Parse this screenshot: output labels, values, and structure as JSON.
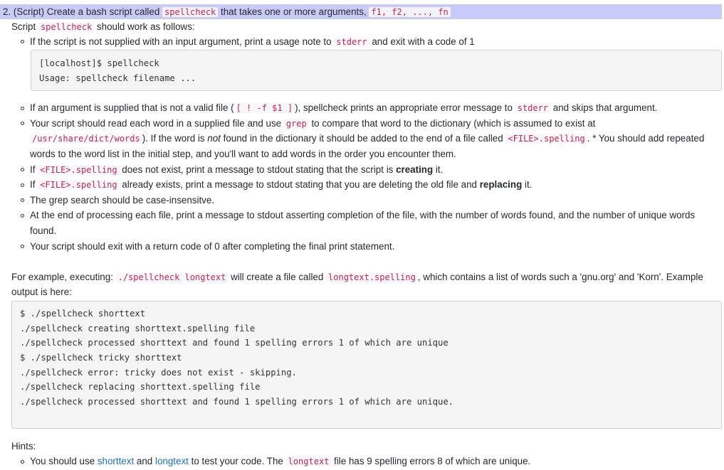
{
  "heading": {
    "prefix": "2. (Script) Create a bash script called ",
    "script_name": "spellcheck",
    "middle": " that takes one or more arguments, ",
    "args": "f1, f2, ..., fn"
  },
  "intro": {
    "pre": "Script ",
    "code": "spellcheck",
    "post": " should work as follows:"
  },
  "bullet1": {
    "pre": "If the script is not supplied with an input argument, print a usage note to ",
    "code": "stderr",
    "post": " and exit with a code of 1"
  },
  "usage_block": [
    "[localhost]$ spellcheck",
    "Usage: spellcheck filename ..."
  ],
  "bullet2": {
    "pre": "If an argument is supplied that is not a valid file (",
    "code1": "[ ! -f $1 ]",
    "mid": "), spellcheck prints an appropriate error message to ",
    "code2": "stderr",
    "post": " and skips that argument."
  },
  "bullet3": {
    "l1_pre": "Your script should read each word in a supplied file and use ",
    "l1_code": "grep",
    "l1_post": " to compare that word to the dictionary (which is assumed to exist at",
    "l2_code1": "/usr/share/dict/words",
    "l2_mid1": "). If the word is ",
    "l2_em": "not",
    "l2_mid2": " found in the dictionary it should be added to the end of a file called ",
    "l2_code2": "<FILE>.spelling",
    "l2_post": ". * You should add repeated",
    "l3": "words to the word list in the initial step, and you'll want to add words in the order you encounter them."
  },
  "bullet4": {
    "pre": "If ",
    "code": "<FILE>.spelling",
    "mid": " does not exist, print a message to stdout stating that the script is ",
    "strong": "creating",
    "post": " it."
  },
  "bullet5": {
    "pre": "If ",
    "code": "<FILE>.spelling",
    "mid": " already exists, print a message to stdout stating that you are deleting the old file and ",
    "strong": "replacing",
    "post": " it."
  },
  "bullet6": {
    "text": "The grep search should be case-insensitve."
  },
  "bullet7": {
    "l1": "At the end of processing each file, print a message to stdout asserting completion of the file, with the number of words found, and the number of unique words",
    "l2": "found."
  },
  "bullet8": {
    "text": "Your script should exit with a return code of 0 after completing the final print statement."
  },
  "example": {
    "pre": "For example, executing: ",
    "code1": "./spellcheck longtext",
    "mid": " will create a file called ",
    "code2": "longtext.spelling",
    "post": ", which contains a list of words such a 'gnu.org' and 'Korn'. Example",
    "l2": "output is here:"
  },
  "output_block": [
    "$ ./spellcheck shorttext",
    "./spellcheck creating shorttext.spelling file",
    "./spellcheck processed shorttext and found 1 spelling errors 1 of which are unique",
    "$ ./spellcheck tricky shorttext",
    "./spellcheck error: tricky does not exist - skipping.",
    "./spellcheck replacing shorttext.spelling file",
    "./spellcheck processed shorttext and found 1 spelling errors 1 of which are unique."
  ],
  "hints": {
    "title": "Hints:",
    "pre": "You should use ",
    "link1": "shorttext",
    "and": " and ",
    "link2": "longtext",
    "mid": " to test your code. The ",
    "code": "longtext",
    "post": " file has 9 spelling errors 8 of which are unique."
  }
}
